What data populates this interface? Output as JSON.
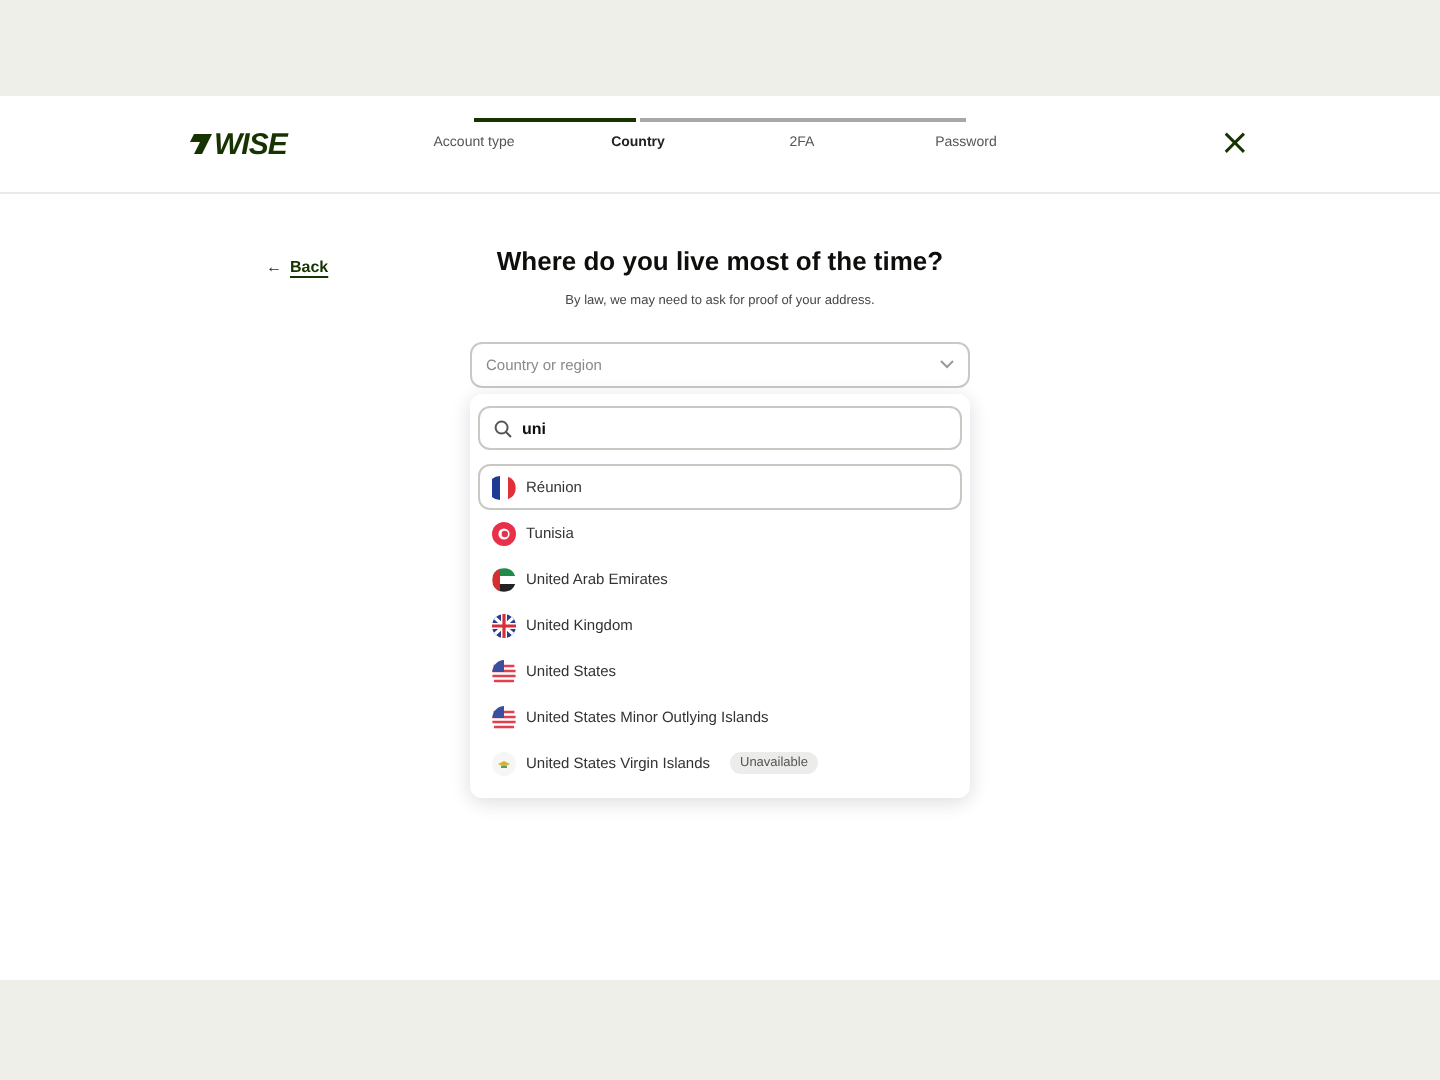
{
  "header": {
    "logo": "WISE",
    "progress": {
      "level": 0.33
    },
    "steps": [
      {
        "label": "Account type",
        "selected": false
      },
      {
        "label": "Country",
        "selected": true
      },
      {
        "label": "2FA",
        "selected": false
      },
      {
        "label": "Password",
        "selected": false
      }
    ],
    "close": "×"
  },
  "back": {
    "arrow": "←",
    "label": "Back"
  },
  "title": "Where do you live most of the time?",
  "subtitle": "By law, we may need to ask for proof of your address.",
  "select": {
    "placeholder": "Country or region",
    "expanded": true
  },
  "search": {
    "value": "uni"
  },
  "options": [
    {
      "label": "Réunion",
      "selected": true
    },
    {
      "label": "Tunisia",
      "selected": false
    },
    {
      "label": "United Arab Emirates",
      "selected": false
    },
    {
      "label": "United Kingdom",
      "selected": false
    },
    {
      "label": "United States",
      "selected": false
    },
    {
      "label": "United States Minor Outlying Islands",
      "selected": false
    },
    {
      "label": "United States Virgin Islands",
      "selected": false,
      "badge": "Unavailable"
    }
  ]
}
